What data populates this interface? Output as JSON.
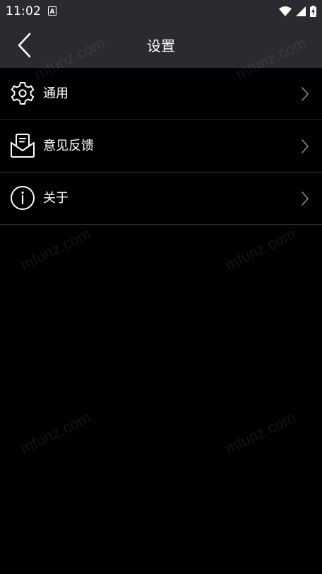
{
  "status_bar": {
    "time": "11:02",
    "notification_icon": "a-text-icon",
    "wifi_icon": "wifi-icon",
    "signal_icon": "cell-signal-icon",
    "battery_icon": "battery-charging-icon"
  },
  "app_bar": {
    "back_icon": "chevron-left-icon",
    "title": "设置"
  },
  "menu": {
    "items": [
      {
        "label": "通用",
        "icon": "gear-icon",
        "trailing_icon": "chevron-right-icon"
      },
      {
        "label": "意见反馈",
        "icon": "feedback-envelope-icon",
        "trailing_icon": "chevron-right-icon"
      },
      {
        "label": "关于",
        "icon": "info-circle-icon",
        "trailing_icon": "chevron-right-icon"
      }
    ]
  },
  "watermark": {
    "text": "mfunz.com"
  },
  "colors": {
    "background": "#000000",
    "bar": "#2b2a30",
    "divider": "#2e2e2e",
    "text": "#ffffff",
    "chevron": "#8a8a8a"
  }
}
